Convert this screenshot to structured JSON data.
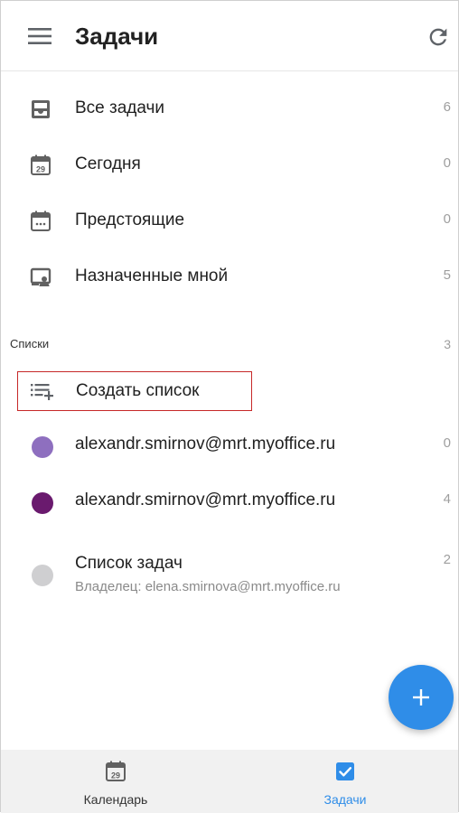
{
  "header": {
    "title": "Задачи",
    "menu_icon": "hamburger-menu-icon",
    "refresh_icon": "refresh-icon"
  },
  "filters": [
    {
      "label": "Все задачи",
      "count": "6",
      "icon": "inbox-tray-icon"
    },
    {
      "label": "Сегодня",
      "count": "0",
      "icon": "calendar-day-icon",
      "day": "29"
    },
    {
      "label": "Предстоящие",
      "count": "0",
      "icon": "calendar-upcoming-icon"
    },
    {
      "label": "Назначенные мной",
      "count": "5",
      "icon": "assigned-by-me-icon"
    }
  ],
  "lists_section": {
    "label": "Списки",
    "count": "3",
    "create_label": "Создать список",
    "create_icon": "playlist-add-icon"
  },
  "lists": [
    {
      "label": "alexandr.smirnov@mrt.myoffice.ru",
      "count": "0",
      "color": "#8e6fbf"
    },
    {
      "label": "alexandr.smirnov@mrt.myoffice.ru",
      "count": "4",
      "color": "#6a1a6e"
    },
    {
      "label": "Список задач",
      "count": "2",
      "color": "#cfcfd1",
      "subtitle": "Владелец: elena.smirnova@mrt.myoffice.ru"
    }
  ],
  "fab": {
    "icon": "plus-icon",
    "color": "#2f8de8"
  },
  "bottom_nav": [
    {
      "label": "Календарь",
      "icon": "calendar-icon",
      "day": "29",
      "active": false
    },
    {
      "label": "Задачи",
      "icon": "checkbox-icon",
      "active": true
    }
  ],
  "colors": {
    "accent": "#2f8de8",
    "icon_gray": "#616161",
    "highlight_border": "#c62828"
  }
}
